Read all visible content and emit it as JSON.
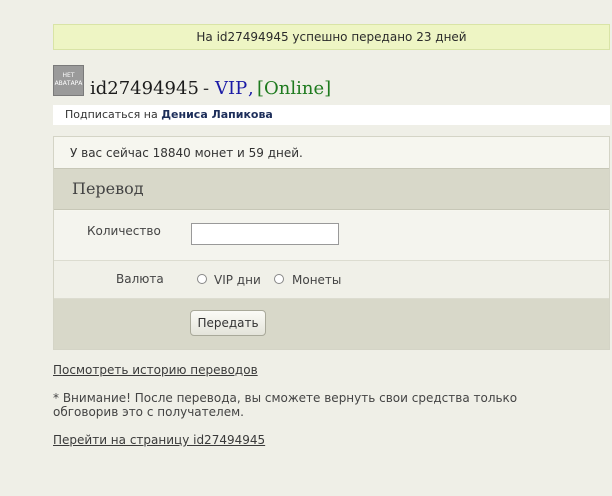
{
  "notice": {
    "text": "На id27494945 успешно передано 23 дней"
  },
  "profile": {
    "avatar_line1": "НЕТ",
    "avatar_line2": "АВАТАРА",
    "username": "id27494945",
    "dash": "-",
    "vip": "VIP",
    "comma": ",",
    "online": "[Online]"
  },
  "subscribe": {
    "prefix": "Подписаться на",
    "name": "Дениса Лапикова"
  },
  "balance_text": "У вас сейчас 18840 монет и 59 дней.",
  "transfer": {
    "title": "Перевод",
    "quantity_label": "Количество",
    "quantity_value": "",
    "currency_label": "Валюта",
    "options": [
      "VIP дни",
      "Монеты"
    ],
    "submit_label": "Передать"
  },
  "links": {
    "history": "Посмотреть историю переводов",
    "warning": "* Внимание! После перевода, вы сможете вернуть свои средства только обговорив это с получателем.",
    "goto_profile": "Перейти на страницу id27494945"
  },
  "colors": {
    "notice_bg": "#eef5c4",
    "vip": "#1a1aa6",
    "online": "#1e7a1e",
    "panel_header": "#d8d8c9"
  }
}
